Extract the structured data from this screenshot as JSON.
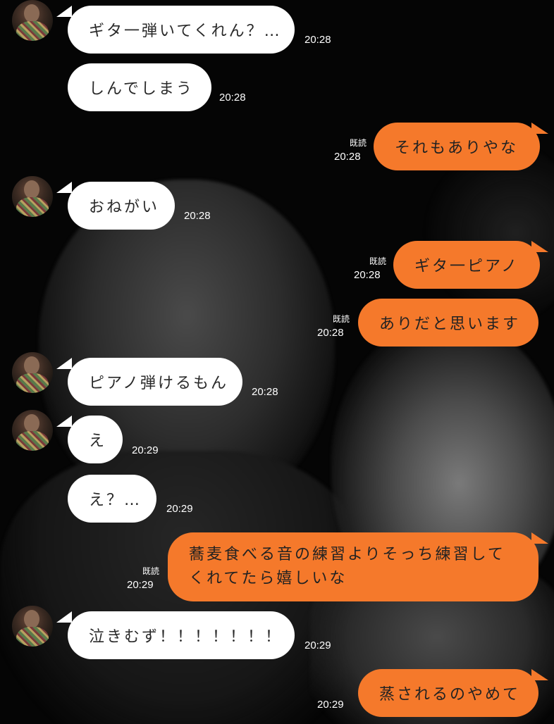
{
  "messages": [
    {
      "side": "in",
      "text": "ギタ一弾いてくれん？…",
      "time": "20:28",
      "read": ""
    },
    {
      "side": "in",
      "text": "しんでしまう",
      "time": "20:28",
      "read": ""
    },
    {
      "side": "out",
      "text": "それもありやな",
      "time": "20:28",
      "read": "既読"
    },
    {
      "side": "in",
      "text": "おねがい",
      "time": "20:28",
      "read": ""
    },
    {
      "side": "out",
      "text": "ギタ一ピアノ",
      "time": "20:28",
      "read": "既読"
    },
    {
      "side": "out",
      "text": "ありだと思います",
      "time": "20:28",
      "read": "既読"
    },
    {
      "side": "in",
      "text": "ピアノ弾けるもん",
      "time": "20:28",
      "read": ""
    },
    {
      "side": "in",
      "text": "え",
      "time": "20:29",
      "read": ""
    },
    {
      "side": "in",
      "text": "え？…",
      "time": "20:29",
      "read": ""
    },
    {
      "side": "out",
      "text": "蕎麦食べる音の練習よりそっち練習してくれてたら嬉しいな",
      "time": "20:29",
      "read": "既読"
    },
    {
      "side": "in",
      "text": "泣きむず！！！！！！！",
      "time": "20:29",
      "read": ""
    },
    {
      "side": "out",
      "text": "蒸されるのやめて",
      "time": "20:29",
      "read": ""
    }
  ],
  "colors": {
    "incoming_bubble": "#ffffff",
    "outgoing_bubble": "#f5792b",
    "background": "#050505"
  },
  "icons": {
    "avatar": "contact-avatar"
  }
}
